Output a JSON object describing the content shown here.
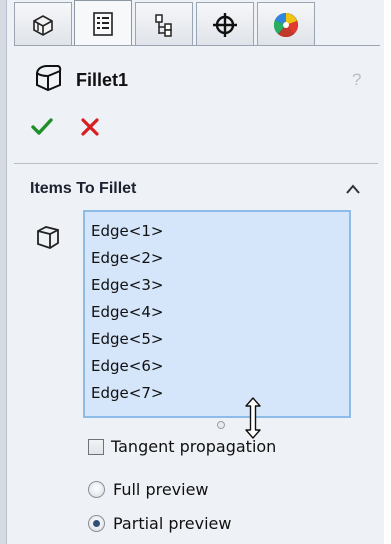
{
  "tabs": [
    {
      "name": "feature-manager",
      "icon": "feature-tree-icon",
      "active": false
    },
    {
      "name": "property-manager",
      "icon": "property-manager-icon",
      "active": true
    },
    {
      "name": "configuration-manager",
      "icon": "configuration-manager-icon",
      "active": false
    },
    {
      "name": "dimxpert-manager",
      "icon": "crosshair-icon",
      "active": false
    },
    {
      "name": "display-manager",
      "icon": "color-wheel-icon",
      "active": false
    }
  ],
  "header": {
    "title": "Fillet1",
    "help_glyph": "?"
  },
  "actions": {
    "ok_icon": "checkmark-icon",
    "cancel_icon": "x-icon",
    "ok_color": "#1f8f2a",
    "cancel_color": "#d81e1e"
  },
  "group": {
    "title": "Items To Fillet",
    "edges": [
      "Edge<1>",
      "Edge<2>",
      "Edge<3>",
      "Edge<4>",
      "Edge<5>",
      "Edge<6>",
      "Edge<7>"
    ],
    "list_background": "#d5e6fa",
    "list_border": "#8dbce8"
  },
  "options": {
    "tangent_label": "Tangent propagation",
    "tangent_checked": false,
    "preview_options": [
      {
        "label": "Full preview",
        "selected": false
      },
      {
        "label": "Partial preview",
        "selected": true
      }
    ]
  }
}
